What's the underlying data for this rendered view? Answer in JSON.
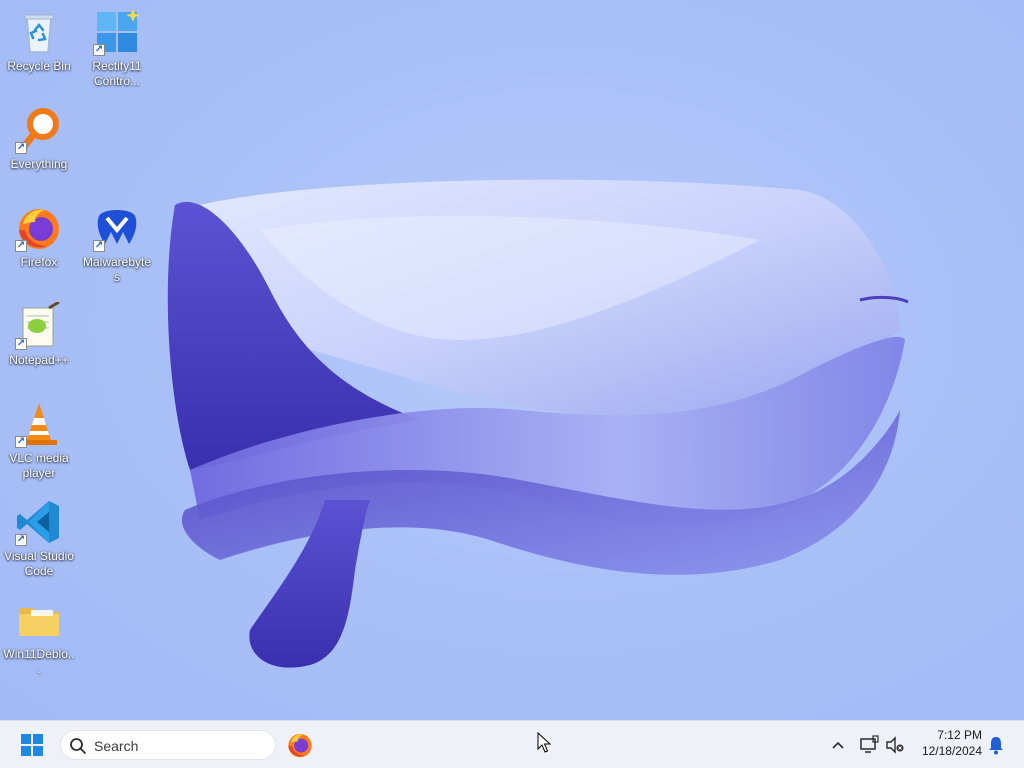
{
  "desktop": {
    "icons": [
      {
        "label": "Recycle Bin"
      },
      {
        "label": "Rectify11 Contro..."
      },
      {
        "label": "Everything"
      },
      {
        "label": "Firefox"
      },
      {
        "label": "Malwarebytes"
      },
      {
        "label": "Notepad++"
      },
      {
        "label": "VLC media player"
      },
      {
        "label": "Visual Studio Code"
      },
      {
        "label": "Win11Deblo..."
      }
    ]
  },
  "taskbar": {
    "search": {
      "text": "Search"
    },
    "clock": {
      "time": "7:12 PM",
      "date": "12/18/2024"
    }
  },
  "colors": {
    "wallpaper_bg": "#a9c0f7",
    "bloom_dark": "#3f35b8",
    "bloom_light": "#c9d3fb",
    "taskbar_bg": "#eef1f7",
    "start_blue": "#1e88e5"
  },
  "icon_names": {
    "recycle_bin": "recycle-bin-icon",
    "rectify": "windows-logo-icon",
    "everything": "magnifier-icon",
    "firefox": "firefox-icon",
    "malwarebytes": "malwarebytes-icon",
    "notepadpp": "notepad-plus-plus-icon",
    "vlc": "traffic-cone-icon",
    "vscode": "vscode-icon",
    "folder": "folder-icon"
  }
}
